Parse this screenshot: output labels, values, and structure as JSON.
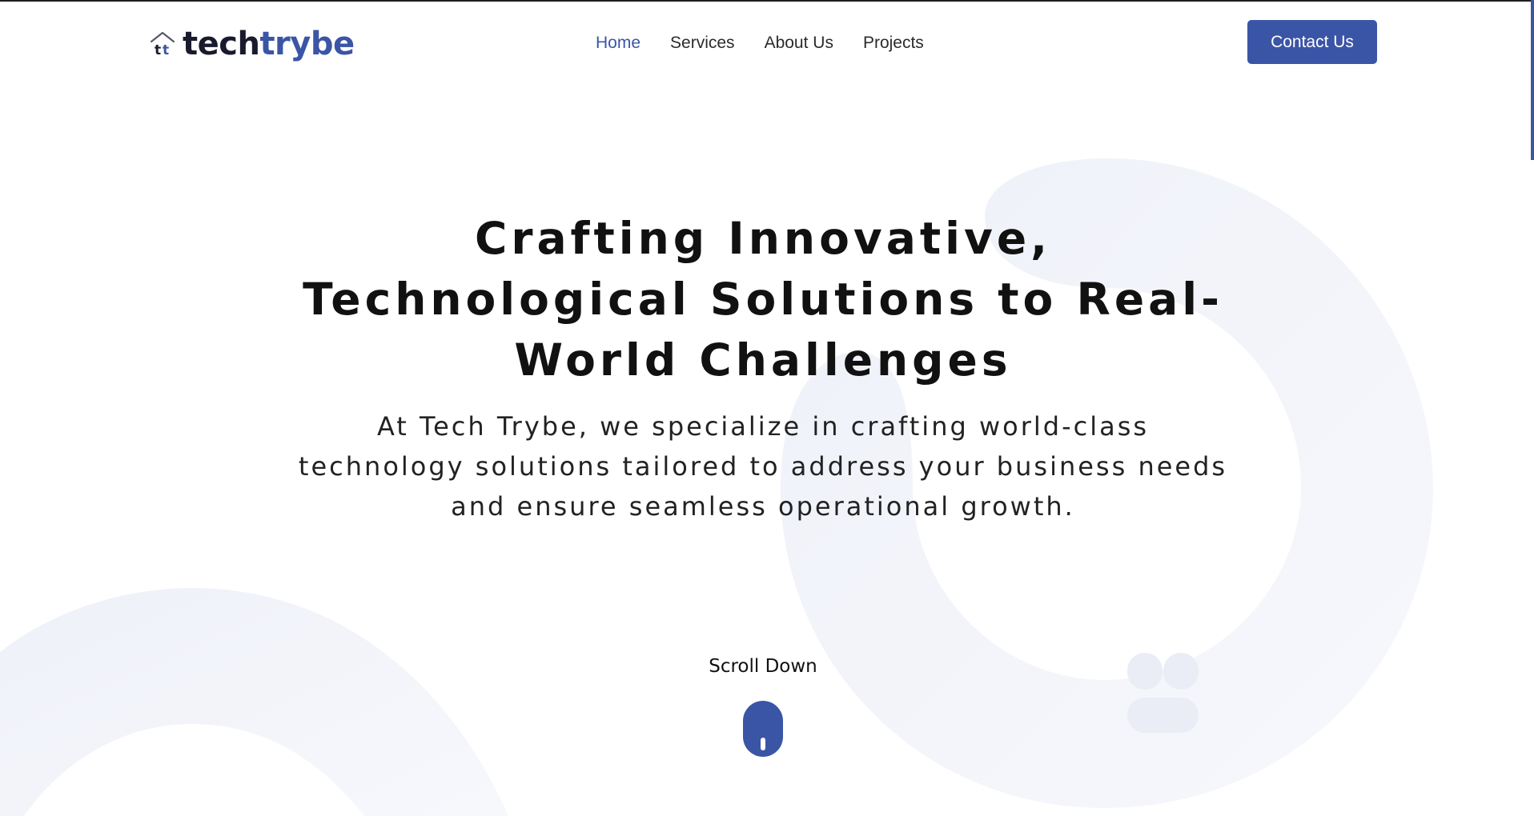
{
  "brand": {
    "name_part1": "tech",
    "name_part2": "trybe",
    "accent_color": "#3b55a6",
    "logo_icon": "house-tt-icon"
  },
  "nav": {
    "items": [
      {
        "label": "Home",
        "active": true
      },
      {
        "label": "Services",
        "active": false
      },
      {
        "label": "About Us",
        "active": false
      },
      {
        "label": "Projects",
        "active": false
      }
    ],
    "cta_label": "Contact Us"
  },
  "hero": {
    "title": "Crafting Innovative, Technological Solutions to Real-World Challenges",
    "subtitle": "At Tech Trybe, we specialize in crafting world-class technology solutions tailored to address your business needs and ensure seamless operational growth."
  },
  "scroll": {
    "label": "Scroll Down",
    "icon": "mouse-icon"
  }
}
